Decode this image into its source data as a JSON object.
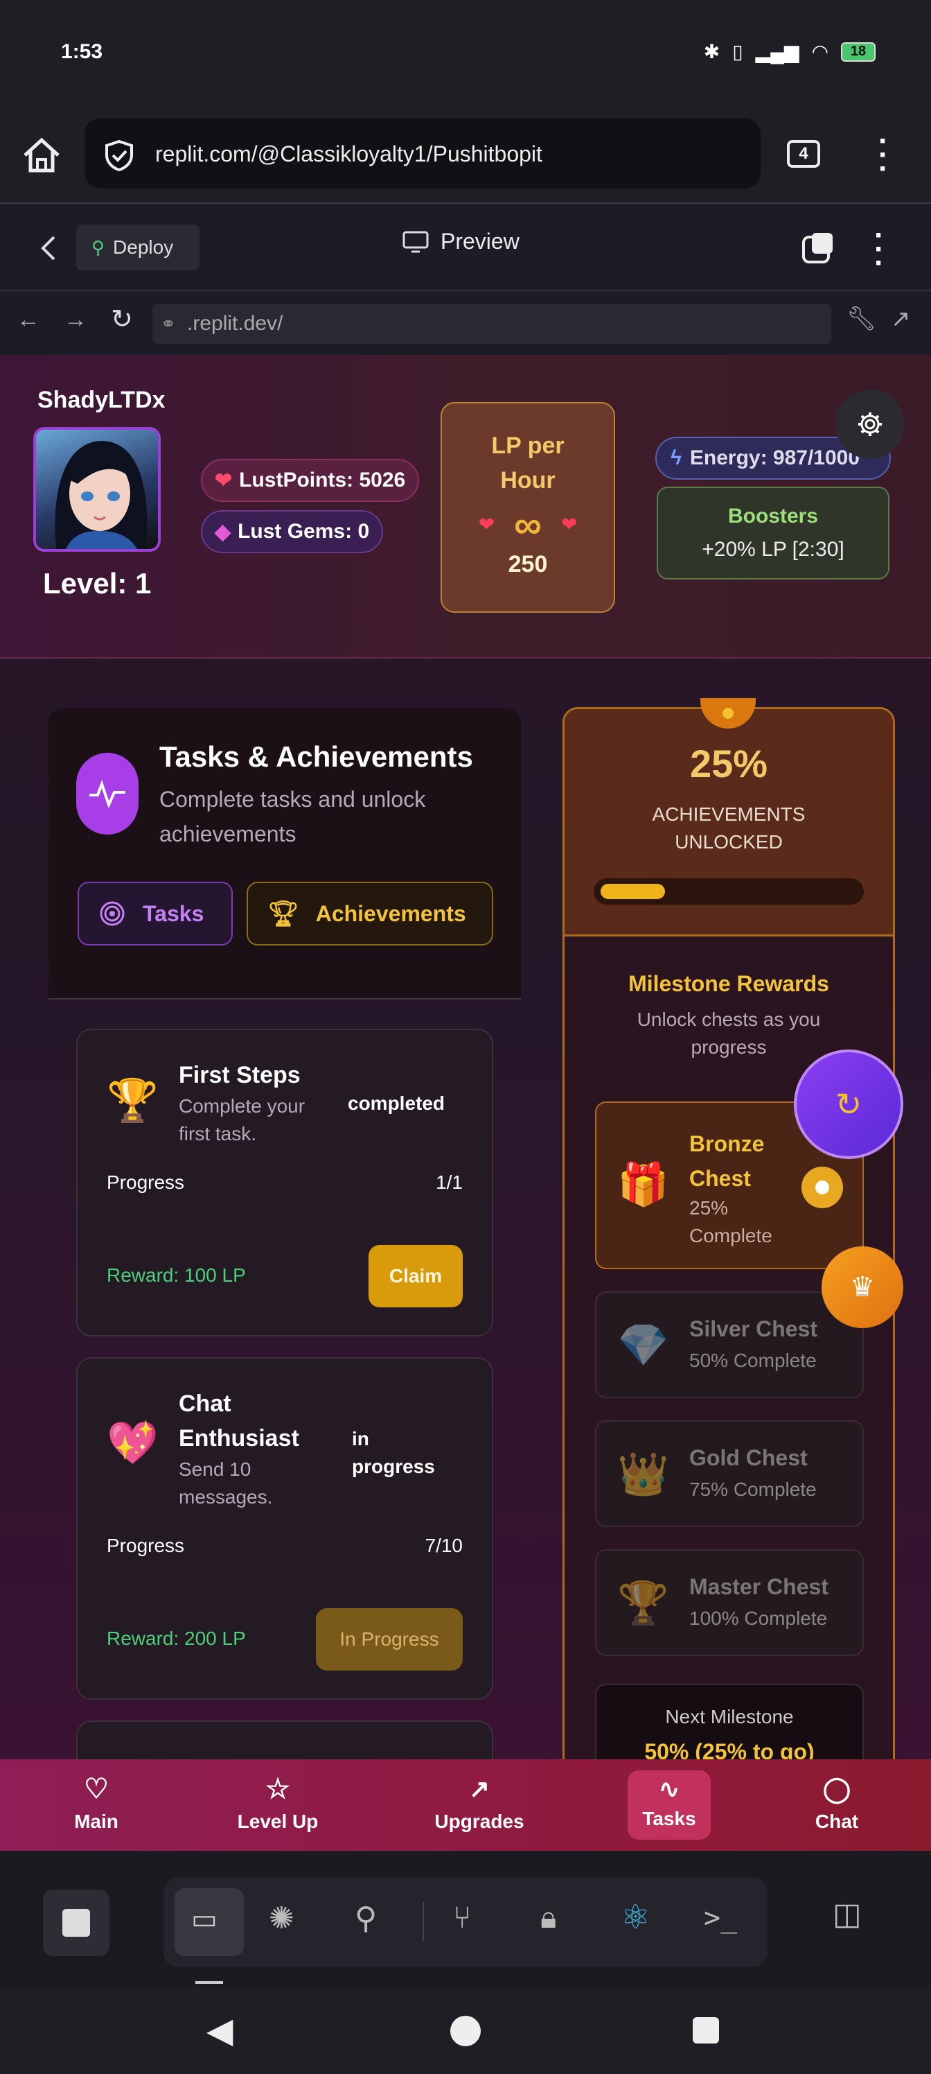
{
  "status_bar": {
    "time": "1:53",
    "battery": "18"
  },
  "browser": {
    "url": "replit.com/@Classikloyalty1/Pushitbopit",
    "tab_count": "4"
  },
  "replit": {
    "deploy_label": "Deploy",
    "preview_label": "Preview",
    "dev_url": ".replit.dev/"
  },
  "header": {
    "username": "ShadyLTDx",
    "level": "Level: 1",
    "lust_points": "LustPoints: 5026",
    "lust_gems": "Lust Gems: 0",
    "lp_per_hour_title": "LP per Hour",
    "lp_per_hour_symbol": "∞",
    "lp_per_hour_value": "250",
    "energy": "Energy: 987/1000",
    "boosters_title": "Boosters",
    "boosters_value": "+20% LP [2:30]"
  },
  "tasks_panel": {
    "title": "Tasks & Achievements",
    "subtitle": "Complete tasks and unlock achievements",
    "tab_tasks": "Tasks",
    "tab_achievements": "Achievements"
  },
  "tasks": [
    {
      "emoji": "🏆",
      "title": "First Steps",
      "desc": "Complete your first task.",
      "status": "completed",
      "progress_label": "Progress",
      "progress": "1/1",
      "reward": "Reward: 100 LP",
      "button": "Claim"
    },
    {
      "emoji": "💖",
      "title": "Chat Enthusiast",
      "desc": "Send 10 messages.",
      "status": "in progress",
      "progress_label": "Progress",
      "progress": "7/10",
      "reward": "Reward: 200 LP",
      "button": "In Progress"
    }
  ],
  "milestones": {
    "percent": "25%",
    "percent_value": 25,
    "unlocked_label": "ACHIEVEMENTS UNLOCKED",
    "rewards_title": "Milestone Rewards",
    "rewards_subtitle": "Unlock chests as you progress",
    "chests": [
      {
        "emoji": "🎁",
        "name": "Bronze Chest",
        "status": "25% Complete"
      },
      {
        "emoji": "💎",
        "name": "Silver Chest",
        "status": "50% Complete"
      },
      {
        "emoji": "👑",
        "name": "Gold Chest",
        "status": "75% Complete"
      },
      {
        "emoji": "🏆",
        "name": "Master Chest",
        "status": "100% Complete"
      }
    ],
    "next_label": "Next Milestone",
    "next_value": "50% (25% to go)"
  },
  "nav": {
    "main": "Main",
    "level_up": "Level Up",
    "upgrades": "Upgrades",
    "tasks": "Tasks",
    "chat": "Chat"
  },
  "colors": {
    "accent_purple": "#a73ee8",
    "gold": "#f3c96a",
    "green": "#4ad07a",
    "claim": "#d99a0b"
  }
}
